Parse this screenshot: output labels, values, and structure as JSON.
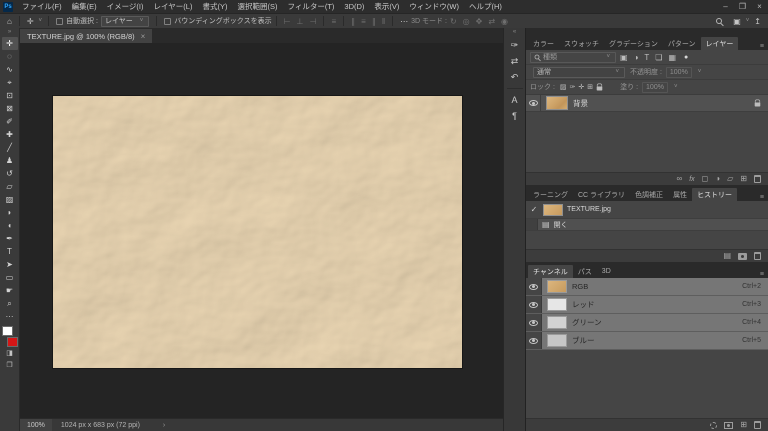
{
  "window": {
    "logo": "Ps",
    "minimize": "–",
    "restore": "❐",
    "close": "×"
  },
  "menubar": {
    "items": [
      "ファイル(F)",
      "編集(E)",
      "イメージ(I)",
      "レイヤー(L)",
      "書式(Y)",
      "選択範囲(S)",
      "フィルター(T)",
      "3D(D)",
      "表示(V)",
      "ウィンドウ(W)",
      "ヘルプ(H)"
    ]
  },
  "optionsbar": {
    "home_icon": "⌂",
    "move_icon": "✛",
    "auto_select_label": "自動選択 :",
    "auto_select_value": "レイヤー",
    "bbox_label": "バウンディングボックスを表示",
    "align_icons": [
      "⊢",
      "⊥",
      "⊣",
      "≡"
    ],
    "distribute_icons": [
      "∥",
      "≡",
      "∥",
      "‖"
    ],
    "more_icon": "⋯",
    "mode_label": "3D モード :",
    "mode_icons": [
      "↻",
      "◎",
      "✥",
      "⇄",
      "◉"
    ],
    "workspace_icon": "▣",
    "share_icon": "↥"
  },
  "doc": {
    "tab_title": "TEXTURE.jpg @ 100% (RGB/8)",
    "close": "×"
  },
  "toolbar": {
    "collapse": "»",
    "tools": [
      {
        "name": "move",
        "glyph": "✛"
      },
      {
        "name": "elliptical-marquee",
        "glyph": "◌"
      },
      {
        "name": "lasso",
        "glyph": "∿"
      },
      {
        "name": "object-selection",
        "glyph": "⌖"
      },
      {
        "name": "crop",
        "glyph": "⊡"
      },
      {
        "name": "frame",
        "glyph": "⊠"
      },
      {
        "name": "eyedropper",
        "glyph": "✐"
      },
      {
        "name": "spot-healing-brush",
        "glyph": "✚"
      },
      {
        "name": "brush",
        "glyph": "╱"
      },
      {
        "name": "clone-stamp",
        "glyph": "♟"
      },
      {
        "name": "history-brush",
        "glyph": "↺"
      },
      {
        "name": "eraser",
        "glyph": "▱"
      },
      {
        "name": "gradient",
        "glyph": "▨"
      },
      {
        "name": "blur",
        "glyph": "◗"
      },
      {
        "name": "dodge",
        "glyph": "◖"
      },
      {
        "name": "pen",
        "glyph": "✒"
      },
      {
        "name": "type",
        "glyph": "T"
      },
      {
        "name": "path-selection",
        "glyph": "➤"
      },
      {
        "name": "rectangle",
        "glyph": "▭"
      },
      {
        "name": "hand",
        "glyph": "☛"
      },
      {
        "name": "zoom",
        "glyph": "⌕"
      }
    ],
    "more_icon": "⋯",
    "quick_mask_icon": "◨",
    "screen_mode_icon": "❐"
  },
  "dock": {
    "collapse": "«",
    "brush_settings_icon": "✑",
    "tool_presets_icon": "⇄",
    "snapshot_icon": "↶",
    "character_icon": "A",
    "paragraph_icon": "¶"
  },
  "panels": {
    "group1_tabs": [
      "カラー",
      "スウォッチ",
      "グラデーション",
      "パターン",
      "レイヤー"
    ],
    "panel_menu_icon": "≡",
    "layers": {
      "filter_placeholder": "種類",
      "filter_icons": [
        "▣",
        "◑",
        "T",
        "❏",
        "▦"
      ],
      "pin_icon": "●",
      "blend_mode": "通常",
      "opacity_label": "不透明度 :",
      "opacity_value": "100%",
      "lock_label": "ロック :",
      "lock_icons": [
        "▨",
        "✑",
        "✛",
        "⊞"
      ],
      "fill_label": "塗り :",
      "fill_value": "100%",
      "layer_name": "背景",
      "bottom_icons": {
        "link": "∞",
        "fx": "fx",
        "mask": "◻",
        "adjustment": "◑",
        "group": "▱",
        "new_layer": "⊞"
      }
    },
    "group2_tabs": [
      "ラーニング",
      "CC ライブラリ",
      "色調補正",
      "属性",
      "ヒストリー"
    ],
    "history": {
      "snapshot_name": "TEXTURE.jpg",
      "doc_icon": "▤",
      "state_open": "開く",
      "newdoc_icon": "▤"
    },
    "group3_tabs": [
      "チャンネル",
      "パス",
      "3D"
    ],
    "channels": {
      "rows": [
        {
          "name": "RGB",
          "shortcut": "Ctrl+2"
        },
        {
          "name": "レッド",
          "shortcut": "Ctrl+3"
        },
        {
          "name": "グリーン",
          "shortcut": "Ctrl+4"
        },
        {
          "name": "ブルー",
          "shortcut": "Ctrl+5"
        }
      ],
      "new_channel_icon": "⊞"
    }
  },
  "statusbar": {
    "zoom": "100%",
    "dimensions": "1024 px x 683 px (72 ppi)",
    "chevron": "›"
  },
  "colors": {
    "canvas_paper": "#cfa36b",
    "foreground_swatch": "#ffffff",
    "background_swatch": "#d41616",
    "ps_logo_blue": "#31a8ff",
    "panel_bg": "#454545",
    "selected_channel_row": "#767676",
    "pasteboard": "#242424"
  }
}
